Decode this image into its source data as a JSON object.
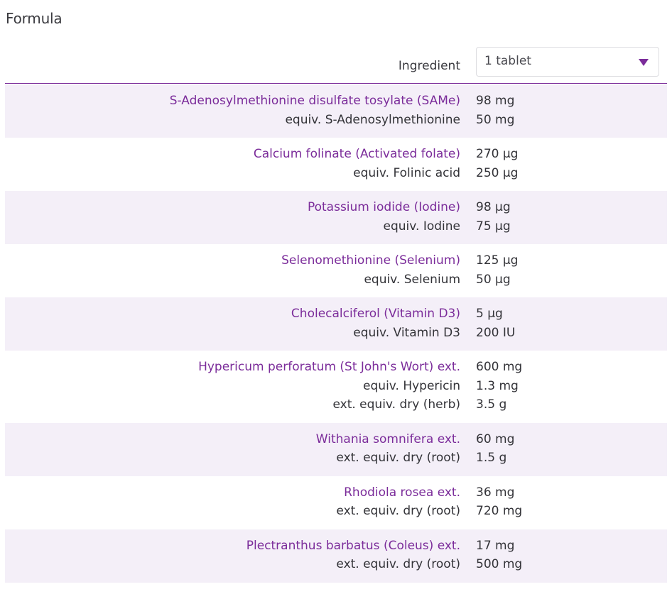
{
  "section": {
    "title": "Formula"
  },
  "header": {
    "ingredient_label": "Ingredient",
    "serving_select": {
      "value": "1 tablet",
      "icon": "caret-down-icon"
    }
  },
  "colors": {
    "accent": "#7b2c9a",
    "shaded_row": "#f4eff8",
    "text": "#333338"
  },
  "ingredients": [
    {
      "name": "S-Adenosylmethionine disulfate tosylate (SAMe)",
      "amount": "98 mg",
      "equivalents": [
        {
          "label": "equiv. S-Adenosylmethionine",
          "amount": "50 mg"
        }
      ]
    },
    {
      "name": "Calcium folinate (Activated folate)",
      "amount": "270 µg",
      "equivalents": [
        {
          "label": "equiv. Folinic acid",
          "amount": "250 µg"
        }
      ]
    },
    {
      "name": "Potassium iodide (Iodine)",
      "amount": "98 µg",
      "equivalents": [
        {
          "label": "equiv. Iodine",
          "amount": "75 µg"
        }
      ]
    },
    {
      "name": "Selenomethionine (Selenium)",
      "amount": "125 µg",
      "equivalents": [
        {
          "label": "equiv. Selenium",
          "amount": "50 µg"
        }
      ]
    },
    {
      "name": "Cholecalciferol (Vitamin D3)",
      "amount": "5 µg",
      "equivalents": [
        {
          "label": "equiv. Vitamin D3",
          "amount": "200 IU"
        }
      ]
    },
    {
      "name": "Hypericum perforatum (St John's Wort) ext.",
      "amount": "600 mg",
      "equivalents": [
        {
          "label": "equiv. Hypericin",
          "amount": "1.3 mg"
        },
        {
          "label": "ext. equiv. dry (herb)",
          "amount": "3.5 g"
        }
      ]
    },
    {
      "name": "Withania somnifera ext.",
      "amount": "60 mg",
      "equivalents": [
        {
          "label": "ext. equiv. dry (root)",
          "amount": "1.5 g"
        }
      ]
    },
    {
      "name": "Rhodiola rosea ext.",
      "amount": "36 mg",
      "equivalents": [
        {
          "label": "ext. equiv. dry (root)",
          "amount": "720 mg"
        }
      ]
    },
    {
      "name": "Plectranthus barbatus (Coleus) ext.",
      "amount": "17 mg",
      "equivalents": [
        {
          "label": "ext. equiv. dry (root)",
          "amount": "500 mg"
        }
      ]
    }
  ]
}
